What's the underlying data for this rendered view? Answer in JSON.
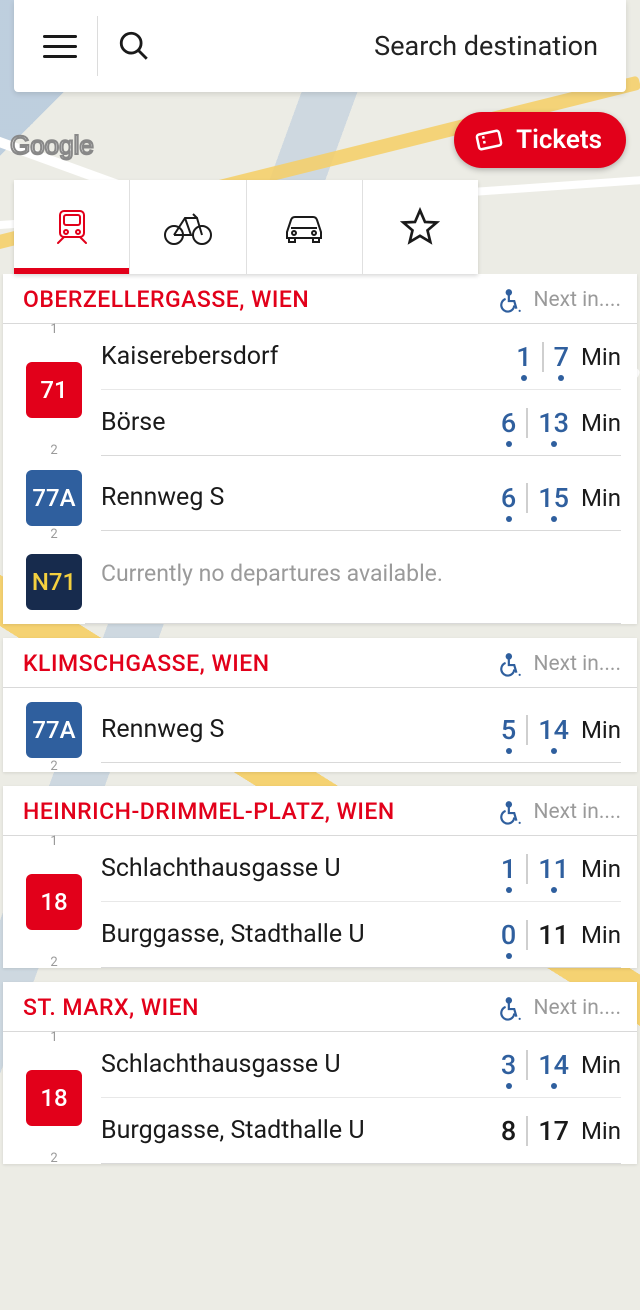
{
  "search": {
    "placeholder": "Search destination"
  },
  "map": {
    "attribution": "Google"
  },
  "tickets_button": {
    "label": "Tickets"
  },
  "tabs": {
    "active_index": 0
  },
  "common": {
    "next_in_label": "Next in....",
    "min_label": "Min",
    "no_departures": "Currently no departures available."
  },
  "stations": [
    {
      "name": "OBERZELLERGASSE, WIEN",
      "accessible": true,
      "lines": [
        {
          "badge": "71",
          "badge_class": "badge-71",
          "platforms_label_top": "1",
          "platforms_label_bottom": "2",
          "destinations": [
            {
              "name": "Kaiserebersdorf",
              "t1": "1",
              "t1_rt": true,
              "t2": "7",
              "t2_rt": true
            },
            {
              "name": "Börse",
              "t1": "6",
              "t1_rt": true,
              "t2": "13",
              "t2_rt": true
            }
          ]
        },
        {
          "badge": "77A",
          "badge_class": "badge-77a",
          "platforms_label_bottom": "2",
          "destinations": [
            {
              "name": "Rennweg S",
              "t1": "6",
              "t1_rt": true,
              "t2": "15",
              "t2_rt": true
            }
          ]
        },
        {
          "badge": "N71",
          "badge_class": "badge-n71",
          "no_departures": true
        }
      ]
    },
    {
      "name": "KLIMSCHGASSE, WIEN",
      "accessible": true,
      "lines": [
        {
          "badge": "77A",
          "badge_class": "badge-77a",
          "platforms_label_bottom": "2",
          "destinations": [
            {
              "name": "Rennweg S",
              "t1": "5",
              "t1_rt": true,
              "t2": "14",
              "t2_rt": true
            }
          ]
        }
      ]
    },
    {
      "name": "HEINRICH-DRIMMEL-PLATZ, WIEN",
      "accessible": true,
      "lines": [
        {
          "badge": "18",
          "badge_class": "badge-18",
          "platforms_label_top": "1",
          "platforms_label_bottom": "2",
          "destinations": [
            {
              "name": "Schlachthausgasse U",
              "t1": "1",
              "t1_rt": true,
              "t2": "11",
              "t2_rt": true
            },
            {
              "name": "Burggasse, Stadthalle U",
              "t1": "0",
              "t1_rt": true,
              "t2": "11",
              "t2_rt": false
            }
          ]
        }
      ]
    },
    {
      "name": "ST. MARX, WIEN",
      "accessible": true,
      "lines": [
        {
          "badge": "18",
          "badge_class": "badge-18",
          "platforms_label_top": "1",
          "platforms_label_bottom": "2",
          "destinations": [
            {
              "name": "Schlachthausgasse U",
              "t1": "3",
              "t1_rt": true,
              "t2": "14",
              "t2_rt": true
            },
            {
              "name": "Burggasse, Stadthalle U",
              "t1": "8",
              "t1_rt": false,
              "t2": "17",
              "t2_rt": false
            }
          ]
        }
      ]
    }
  ]
}
